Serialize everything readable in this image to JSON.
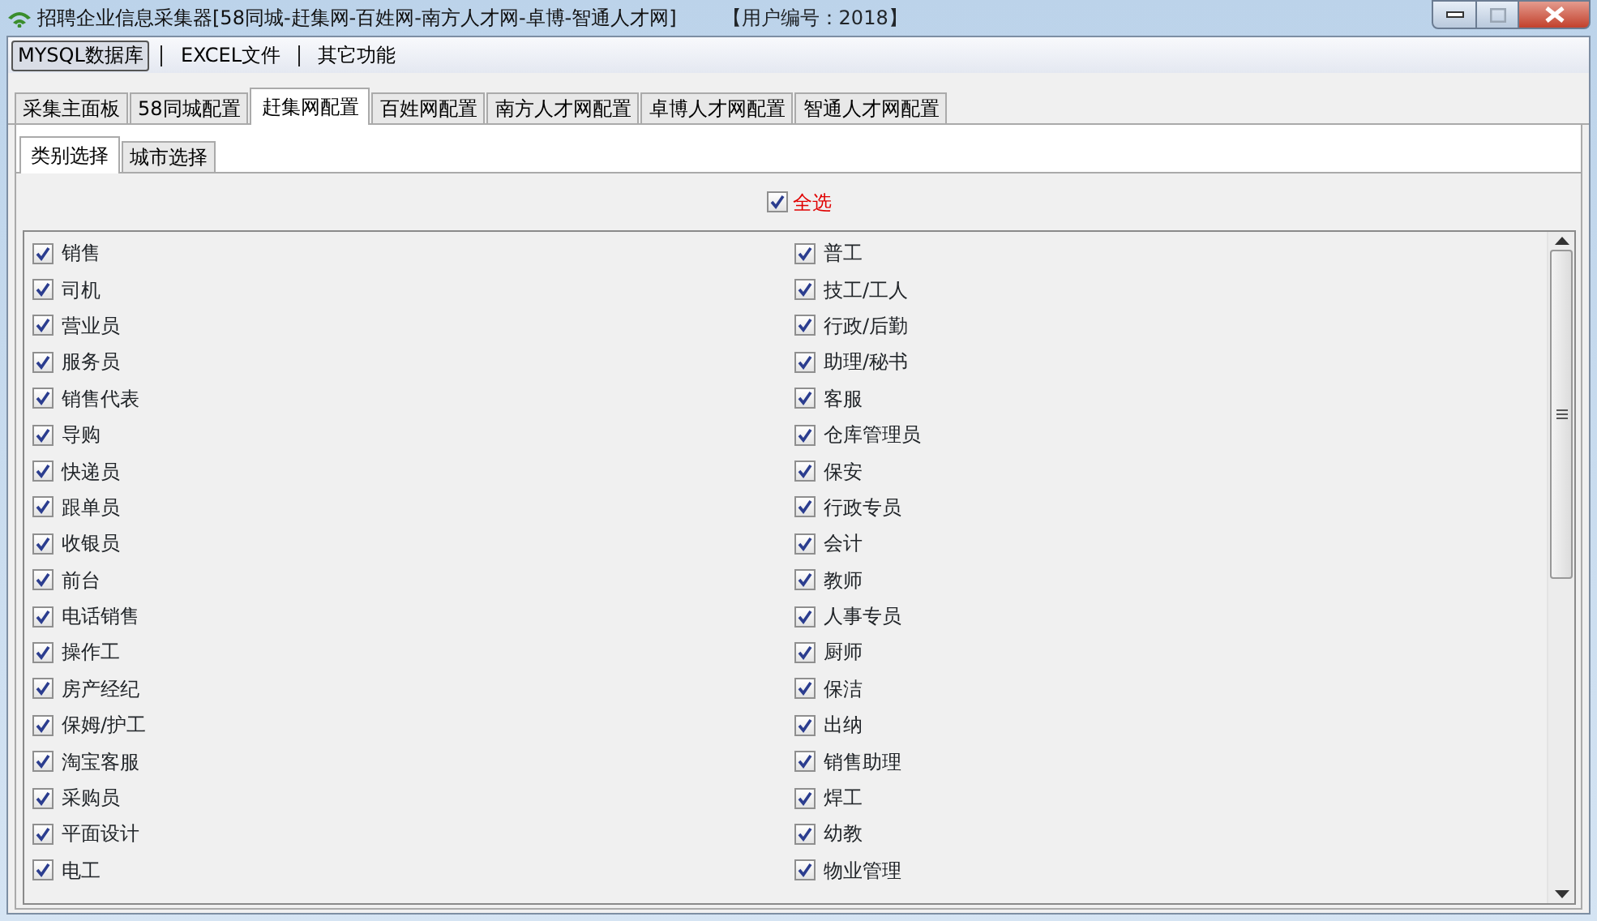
{
  "window": {
    "title": "招聘企业信息采集器[58同城-赶集网-百姓网-南方人才网-卓博-智通人才网]",
    "user_id": "【用户编号：2018】",
    "maximize_disabled": true
  },
  "menu": [
    {
      "label": "MYSQL数据库",
      "selected": true
    },
    {
      "label": "EXCEL文件",
      "selected": false
    },
    {
      "label": "其它功能",
      "selected": false
    }
  ],
  "tabs": [
    {
      "label": "采集主面板",
      "selected": false
    },
    {
      "label": "58同城配置",
      "selected": false
    },
    {
      "label": "赶集网配置",
      "selected": true
    },
    {
      "label": "百姓网配置",
      "selected": false
    },
    {
      "label": "南方人才网配置",
      "selected": false
    },
    {
      "label": "卓博人才网配置",
      "selected": false
    },
    {
      "label": "智通人才网配置",
      "selected": false
    }
  ],
  "subtabs": [
    {
      "label": "类别选择",
      "selected": true
    },
    {
      "label": "城市选择",
      "selected": false
    }
  ],
  "select_all": {
    "label": "全选",
    "checked": true
  },
  "left_column": [
    {
      "label": "销售",
      "checked": true
    },
    {
      "label": "司机",
      "checked": true
    },
    {
      "label": "营业员",
      "checked": true
    },
    {
      "label": "服务员",
      "checked": true
    },
    {
      "label": "销售代表",
      "checked": true
    },
    {
      "label": "导购",
      "checked": true
    },
    {
      "label": "快递员",
      "checked": true
    },
    {
      "label": "跟单员",
      "checked": true
    },
    {
      "label": "收银员",
      "checked": true
    },
    {
      "label": "前台",
      "checked": true
    },
    {
      "label": "电话销售",
      "checked": true
    },
    {
      "label": "操作工",
      "checked": true
    },
    {
      "label": "房产经纪",
      "checked": true
    },
    {
      "label": "保姆/护工",
      "checked": true
    },
    {
      "label": "淘宝客服",
      "checked": true
    },
    {
      "label": "采购员",
      "checked": true
    },
    {
      "label": "平面设计",
      "checked": true
    },
    {
      "label": "电工",
      "checked": true
    }
  ],
  "right_column": [
    {
      "label": "普工",
      "checked": true
    },
    {
      "label": "技工/工人",
      "checked": true
    },
    {
      "label": "行政/后勤",
      "checked": true
    },
    {
      "label": "助理/秘书",
      "checked": true
    },
    {
      "label": "客服",
      "checked": true
    },
    {
      "label": "仓库管理员",
      "checked": true
    },
    {
      "label": "保安",
      "checked": true
    },
    {
      "label": "行政专员",
      "checked": true
    },
    {
      "label": "会计",
      "checked": true
    },
    {
      "label": "教师",
      "checked": true
    },
    {
      "label": "人事专员",
      "checked": true
    },
    {
      "label": "厨师",
      "checked": true
    },
    {
      "label": "保洁",
      "checked": true
    },
    {
      "label": "出纳",
      "checked": true
    },
    {
      "label": "销售助理",
      "checked": true
    },
    {
      "label": "焊工",
      "checked": true
    },
    {
      "label": "幼教",
      "checked": true
    },
    {
      "label": "物业管理",
      "checked": true
    }
  ]
}
